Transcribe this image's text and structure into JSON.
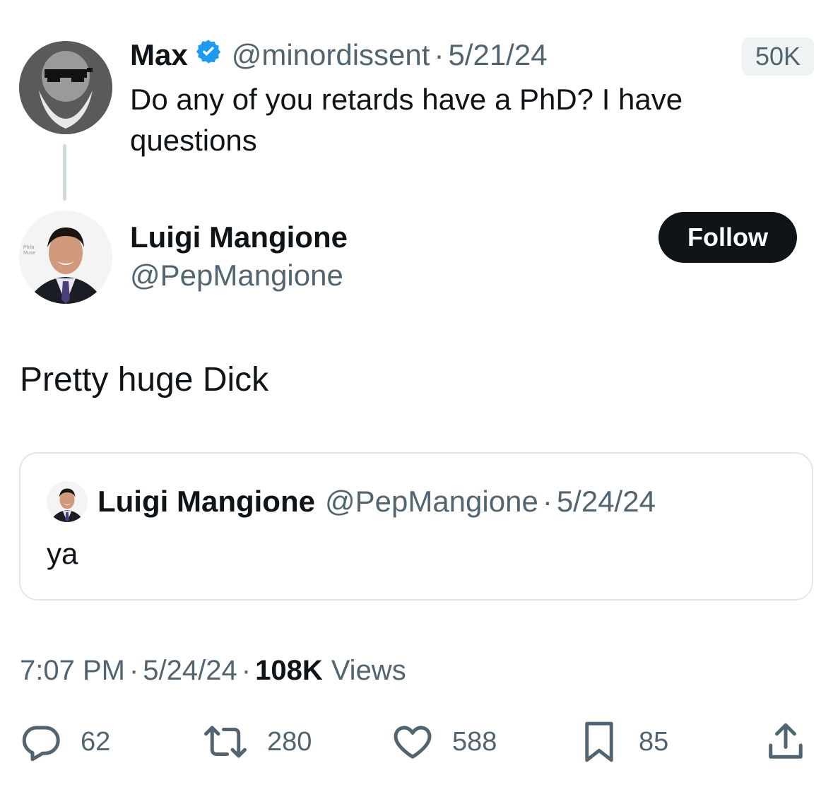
{
  "parent_tweet": {
    "display_name": "Max",
    "handle": "@minordissent",
    "date": "5/21/24",
    "text_line1": "Do any of you retards have a PhD? I have",
    "text_line2": "questions",
    "badge": "50K"
  },
  "main_tweet": {
    "display_name": "Luigi Mangione",
    "handle": "@PepMangione",
    "follow_label": "Follow",
    "text": "Pretty huge Dick"
  },
  "quoted_tweet": {
    "display_name": "Luigi Mangione",
    "handle": "@PepMangione",
    "date": "5/24/24",
    "text": "ya"
  },
  "meta": {
    "time": "7:07 PM",
    "date": "5/24/24",
    "views_count": "108K",
    "views_label": "Views"
  },
  "actions": {
    "replies": "62",
    "reposts": "280",
    "likes": "588",
    "bookmarks": "85"
  },
  "colors": {
    "verified": "#1d9bf0",
    "muted": "#536471",
    "border": "#e1e8ed",
    "button": "#0f1419"
  },
  "icons": [
    "verified-badge-icon",
    "reply-icon",
    "repost-icon",
    "like-icon",
    "bookmark-icon",
    "share-icon"
  ]
}
